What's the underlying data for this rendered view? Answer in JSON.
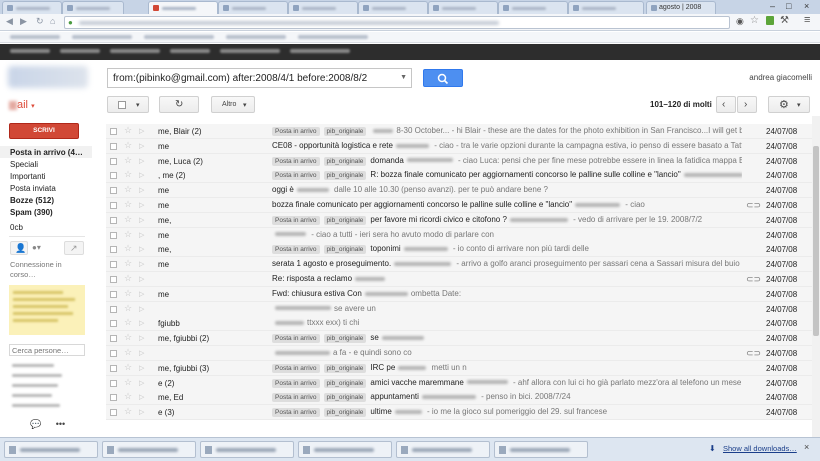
{
  "browser": {
    "active_tab_label": "agosto | 2008",
    "window_controls": [
      "–",
      "□",
      "×"
    ],
    "toolbar_icons": [
      "eye-icon",
      "star-icon",
      "gear-icon",
      "extension-icon",
      "menu-icon"
    ]
  },
  "search": {
    "query": "from:(pibinko@gmail.com) after:2008/4/1 before:2008/8/2"
  },
  "account": {
    "name": "andrea giacomelli"
  },
  "app": {
    "label": "ail"
  },
  "toolbar": {
    "more_label": "Altro",
    "pagination": "101–120 di molti"
  },
  "sidebar": {
    "compose_label": "SCRIVI",
    "items": [
      {
        "label": "Posta in arrivo (4…",
        "bold": true
      },
      {
        "label": "Speciali",
        "bold": false
      },
      {
        "label": "Importanti",
        "bold": false
      },
      {
        "label": "Posta inviata",
        "bold": false
      },
      {
        "label": "Bozze (512)",
        "bold": true
      },
      {
        "label": "Spam (390)",
        "bold": true
      },
      {
        "label": "0cb",
        "bold": false
      }
    ],
    "chat_status": "Connessione in corso…",
    "find_people_placeholder": "Cerca persone…"
  },
  "emails": [
    {
      "sender": "me, Blair (2)",
      "labels": [
        "Posta in arrivo",
        "pib_originale"
      ],
      "subject": "",
      "snippet": "8-30 October... - hi Blair - these are the dates for the photo exhibition in San Francisco...I will get back to",
      "date": "24/07/08",
      "attachment": false
    },
    {
      "sender": "me",
      "labels": [],
      "subject": "CE08 - opportunità logistica e rete",
      "snippet": " - ciao - tra le varie opzioni durante la campagna estiva, io penso di essere basato a Tatti - chi non",
      "date": "24/07/08",
      "attachment": false
    },
    {
      "sender": "me, Luca (2)",
      "labels": [
        "Posta in arrivo",
        "pib_originale"
      ],
      "subject": "domanda",
      "snippet": " - ciao Luca: pensi che per fine mese potrebbe essere in linea la fatidica mappa BMP ? non è una",
      "date": "24/07/08",
      "attachment": false
    },
    {
      "sender": ", me (2)",
      "labels": [
        "Posta in arrivo",
        "pib_originale"
      ],
      "subject": "R: bozza finale comunicato per aggiornamenti concorso le palline sulle colline e \"lancio\"",
      "snippet": " - non c'è problema",
      "date": "24/07/08",
      "attachment": false
    },
    {
      "sender": "me",
      "labels": [],
      "subject": "oggi è",
      "snippet": " dalle 10 alle 10.30 (penso avanzi). per te può andare bene ?",
      "date": "24/07/08",
      "attachment": false
    },
    {
      "sender": "me",
      "labels": [],
      "subject": "bozza finale comunicato per aggiornamenti concorso le palline sulle colline e \"lancio\"",
      "snippet": " - ciao",
      "date": "24/07/08",
      "attachment": true
    },
    {
      "sender": "me,",
      "labels": [
        "Posta in arrivo",
        "pib_originale"
      ],
      "subject": "per favore mi ricordi civico e citofono ?",
      "snippet": " - vedo di arrivare per le 19. 2008/7/2",
      "date": "24/07/08",
      "attachment": false
    },
    {
      "sender": "me",
      "labels": [],
      "subject": "",
      "snippet": " - ciao a tutti - ieri sera ho avuto modo di parlare con",
      "date": "24/07/08",
      "attachment": false
    },
    {
      "sender": "me,",
      "labels": [
        "Posta in arrivo",
        "pib_originale"
      ],
      "subject": "toponimi",
      "snippet": " - io conto di arrivare non più tardi delle",
      "date": "24/07/08",
      "attachment": false
    },
    {
      "sender": "me",
      "labels": [],
      "subject": "serata 1 agosto e proseguimento.",
      "snippet": " - arrivo a golfo aranci proseguimento per sassari cena a Sassari misura del buio nella Nurra.",
      "date": "24/07/08",
      "attachment": false
    },
    {
      "sender": "",
      "labels": [],
      "subject": "Re: risposta a reclamo",
      "snippet": "",
      "date": "24/07/08",
      "attachment": true
    },
    {
      "sender": "me",
      "labels": [],
      "subject": "Fwd: chiusura estiva Con",
      "snippet": "ombetta Date:",
      "date": "24/07/08",
      "attachment": false
    },
    {
      "sender": "",
      "labels": [],
      "subject": "",
      "snippet": "se avere un",
      "date": "24/07/08",
      "attachment": false
    },
    {
      "sender": "fgiubb",
      "labels": [],
      "subject": "",
      "snippet": "ttxxx exx) ti chi",
      "date": "24/07/08",
      "attachment": false
    },
    {
      "sender": "me, fgiubbi (2)",
      "labels": [
        "Posta in arrivo",
        "pib_originale"
      ],
      "subject": "se",
      "snippet": "",
      "date": "24/07/08",
      "attachment": false
    },
    {
      "sender": "",
      "labels": [],
      "subject": "",
      "snippet": "a fa - e quindi sono co",
      "date": "24/07/08",
      "attachment": true
    },
    {
      "sender": "me, fgiubbi (3)",
      "labels": [
        "Posta in arrivo",
        "pib_originale"
      ],
      "subject": "IRC pe",
      "snippet": " metti un n",
      "date": "24/07/08",
      "attachment": false
    },
    {
      "sender": "e (2)",
      "labels": [
        "Posta in arrivo",
        "pib_originale"
      ],
      "subject": "amici vacche maremmane",
      "snippet": " - ahf allora con lui ci ho già parlato mezz'ora al telefono un mese fa!!! interessant",
      "date": "24/07/08",
      "attachment": false
    },
    {
      "sender": "me, Ed",
      "labels": [
        "Posta in arrivo",
        "pib_originale"
      ],
      "subject": "appuntamenti",
      "snippet": " - penso in bici. 2008/7/24",
      "date": "24/07/08",
      "attachment": false
    },
    {
      "sender": "e (3)",
      "labels": [
        "Posta in arrivo",
        "pib_originale"
      ],
      "subject": "ultime",
      "snippet": " - io me la gioco sul pomeriggio del 29. sul francese",
      "date": "24/07/08",
      "attachment": false
    }
  ],
  "downloads": {
    "show_all_label": "Show all downloads…",
    "close_label": "×"
  }
}
